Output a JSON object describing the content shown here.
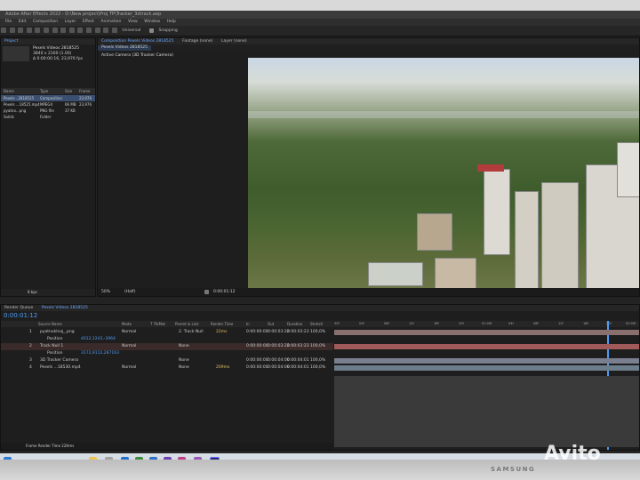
{
  "window": {
    "title": "Adobe After Effects 2022 - D:\\New project\\Proj TP\\Tracker_3dtrack.aep"
  },
  "menu": [
    "File",
    "Edit",
    "Composition",
    "Layer",
    "Effect",
    "Animation",
    "View",
    "Window",
    "Help"
  ],
  "toolbar": {
    "snapping_label": "Snapping",
    "universal_label": "Universal"
  },
  "project": {
    "tab_label": "Project",
    "selected_name": "Pexels Videos 2818525",
    "resolution": "3840 x 2160 (1.00)",
    "duration": "Δ 0:00:00:16, 23,976 fps",
    "columns": [
      "Name",
      "Type",
      "Size",
      "Frame R..."
    ],
    "items": [
      {
        "name": "Pexels ..2818525",
        "type": "Composition",
        "size": "",
        "fps": "23,976"
      },
      {
        "name": "Pexels ...18525.mp4",
        "type": "MPEG4",
        "size": "66 MB",
        "fps": "23,976"
      },
      {
        "name": "pyatno...png",
        "type": "PNG file",
        "size": "37 KB",
        "fps": ""
      },
      {
        "name": "Solids",
        "type": "Folder",
        "size": "",
        "fps": ""
      }
    ],
    "bpc": "8 bpc"
  },
  "composition": {
    "tab_label": "Composition Pexels Videos 2818525",
    "footage_tab": "Footage (none)",
    "layer_tab": "Layer (none)",
    "sub_tab": "Pexels Videos 2818525",
    "camera_label": "Active Camera (3D Tracker Camera)",
    "zoom": "50%",
    "quality": "(Half)",
    "timecode": "0:00:01:12"
  },
  "timeline": {
    "render_queue_tab": "Render Queue",
    "comp_tab": "Pexels Videos 2818525",
    "current_time": "0:00:01:12",
    "columns": [
      "Source Name",
      "Mode",
      "T TrkMat",
      "Parent & Link",
      "Render Time",
      "In",
      "Out",
      "Duration",
      "Stretch"
    ],
    "layers": [
      {
        "num": "1",
        "name": "pyatnoklnaj_.png",
        "mode": "Normal",
        "parent": "2. Track Null",
        "render": "22ms",
        "in": "0:00:00:00",
        "out": "0:00:03:22",
        "dur": "0:00:03:23",
        "stretch": "100,0%"
      },
      {
        "num": "",
        "name": "Position",
        "value": "4012,1243,-3964",
        "mode": "",
        "parent": "",
        "render": "",
        "in": "",
        "out": "",
        "dur": "",
        "stretch": ""
      },
      {
        "num": "2",
        "name": "Track Null 1",
        "mode": "Normal",
        "parent": "None",
        "render": "",
        "in": "0:00:00:00",
        "out": "0:00:03:22",
        "dur": "0:00:03:23",
        "stretch": "100,0%"
      },
      {
        "num": "",
        "name": "Position",
        "value": "3172,9112,287163",
        "mode": "",
        "parent": "",
        "render": "",
        "in": "",
        "out": "",
        "dur": "",
        "stretch": ""
      },
      {
        "num": "3",
        "name": "3D Tracker Camera",
        "mode": "",
        "parent": "None",
        "render": "",
        "in": "0:00:00:00",
        "out": "0:00:04:00",
        "dur": "0:00:04:01",
        "stretch": "100,0%"
      },
      {
        "num": "4",
        "name": "Pexels ...18530.mp4",
        "mode": "Normal",
        "parent": "None",
        "render": "209ms",
        "in": "0:00:00:00",
        "out": "0:00:04:00",
        "dur": "0:00:04:01",
        "stretch": "100,0%"
      }
    ],
    "ruler": [
      "00f",
      "04f",
      "08f",
      "12f",
      "16f",
      "20f",
      "01:00f",
      "04f",
      "08f",
      "12f",
      "16f",
      "20f",
      "02:00f"
    ],
    "frame_render_time": "Frame Render Time  22Hms"
  },
  "brand": "SAMSUNG",
  "watermark": "Avito"
}
